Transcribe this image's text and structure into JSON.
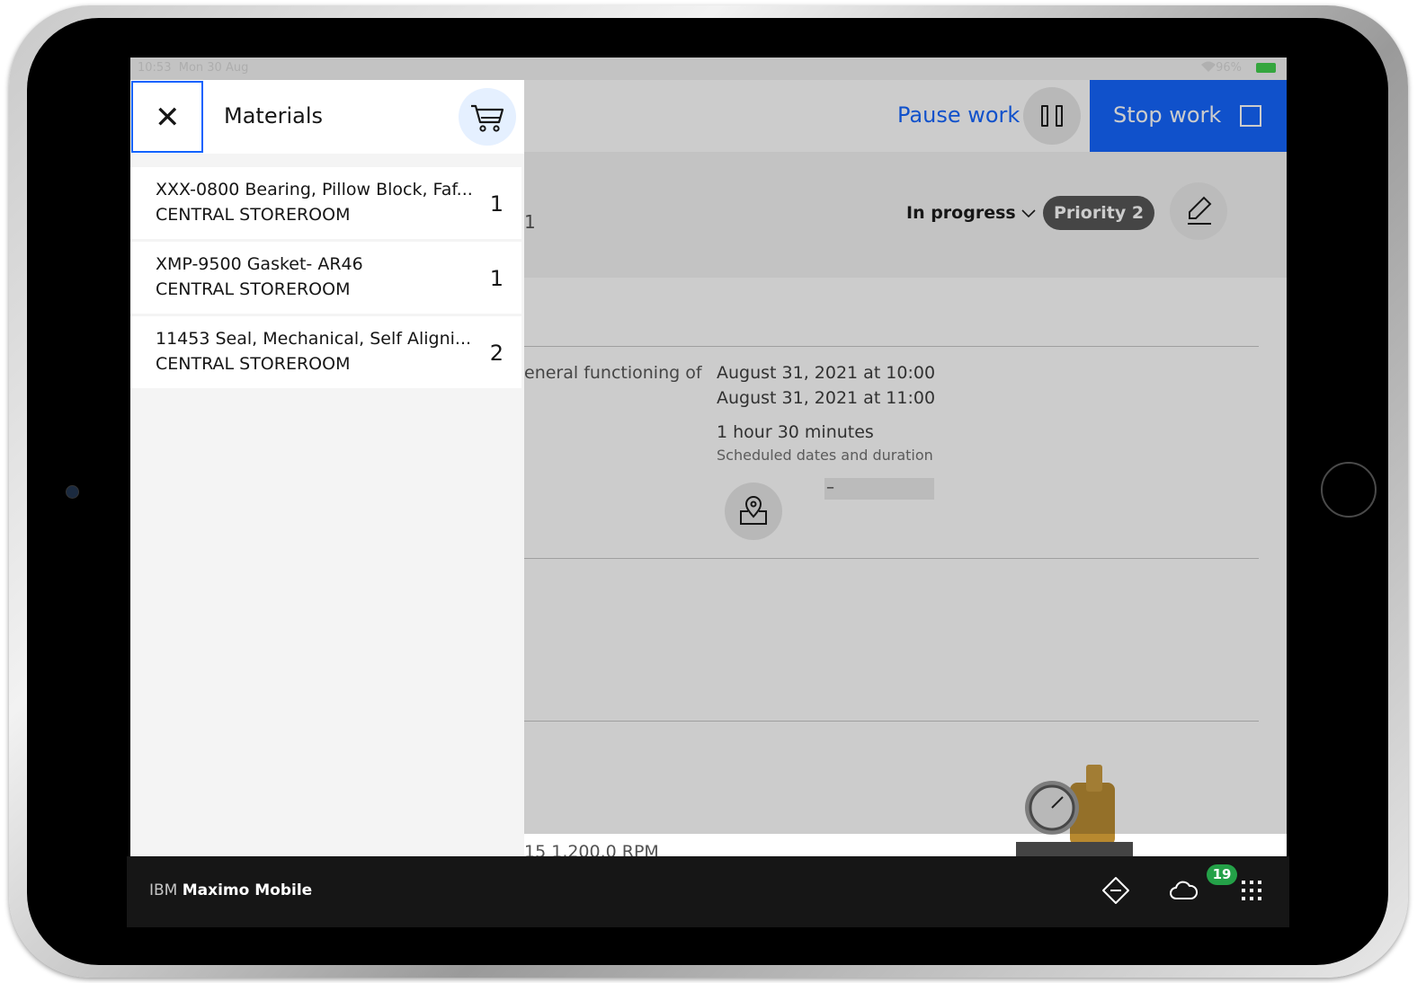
{
  "statusbar": {
    "time": "10:53",
    "date": "Mon 30 Aug",
    "battery": "96%"
  },
  "header": {
    "pause_label": "Pause work",
    "stop_label": "Stop work"
  },
  "workorder": {
    "id_fragment": "1",
    "status": "In progress",
    "priority": "Priority 2",
    "description_fragment": "eneral functioning of",
    "scheduled_start": "August 31, 2021  at  10:00",
    "scheduled_finish": "August 31, 2021  at  11:00",
    "duration": "1 hour 30 minutes",
    "duration_caption": "Scheduled dates and duration",
    "location_placeholder": "–",
    "asset_fragment": "15  1,200.0 RPM"
  },
  "materials_panel": {
    "title": "Materials",
    "items": [
      {
        "description": "XXX-0800 Bearing, Pillow Block, Faf...",
        "storeroom": "CENTRAL STOREROOM",
        "quantity": "1"
      },
      {
        "description": "XMP-9500 Gasket- AR46",
        "storeroom": "CENTRAL STOREROOM",
        "quantity": "1"
      },
      {
        "description": "11453 Seal, Mechanical, Self Aligni...",
        "storeroom": "CENTRAL STOREROOM",
        "quantity": "2"
      }
    ]
  },
  "footer": {
    "brand_prefix": "IBM",
    "brand_name": "Maximo Mobile",
    "sync_badge": "19"
  },
  "icons": {
    "close": "close-icon",
    "cart": "cart-icon",
    "pause": "pause-icon",
    "stop": "stop-icon",
    "edit": "edit-icon",
    "map": "map-pin-icon",
    "navigator": "navigator-icon",
    "cloud": "cloud-icon",
    "apps": "app-grid-icon"
  },
  "colors": {
    "accent": "#0f62fe",
    "footer_bg": "#161616",
    "badge": "#24a148"
  }
}
